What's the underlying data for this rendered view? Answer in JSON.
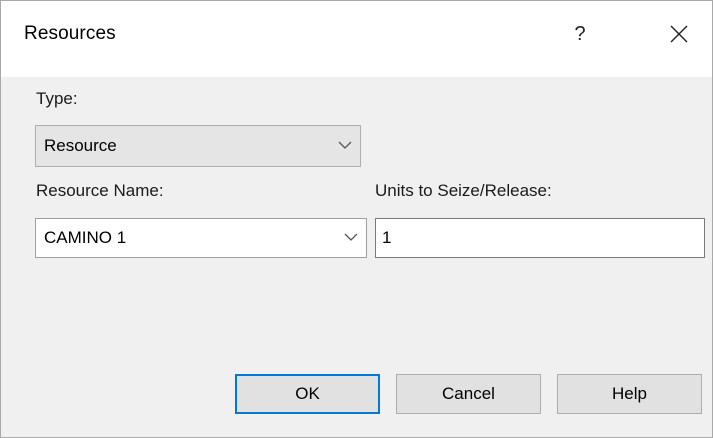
{
  "dialog": {
    "title": "Resources",
    "help_glyph": "?",
    "close_glyph": "✕"
  },
  "form": {
    "type_label": "Type:",
    "type_value": "Resource",
    "resource_name_label": "Resource Name:",
    "resource_name_value": "CAMINO 1",
    "units_label": "Units to Seize/Release:",
    "units_value": "1"
  },
  "buttons": {
    "ok": "OK",
    "cancel": "Cancel",
    "help": "Help"
  },
  "colors": {
    "accent": "#0078d7",
    "dialog_bg": "#f0f0f0",
    "title_bg": "#ffffff"
  }
}
